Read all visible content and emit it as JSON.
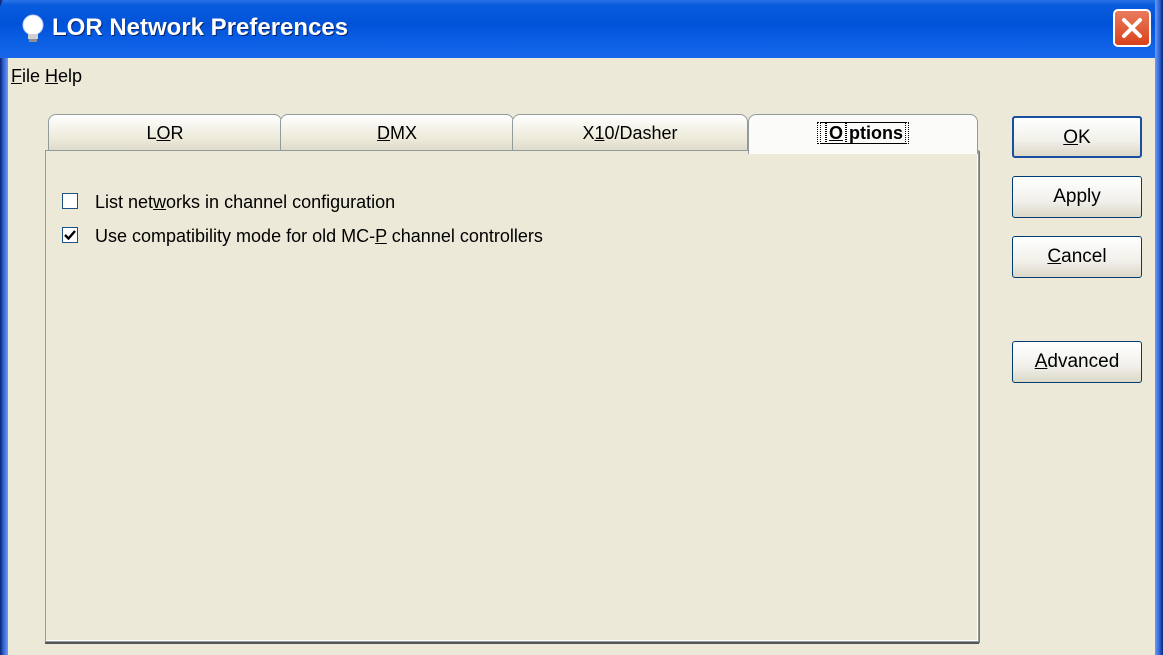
{
  "window": {
    "title": "LOR Network Preferences"
  },
  "menu": [
    {
      "label": "File",
      "mnemonic": "F",
      "rest": "ile"
    },
    {
      "label": "Help",
      "mnemonic": "H",
      "rest": "elp"
    }
  ],
  "tabs": [
    {
      "label": "LOR",
      "pre": "L",
      "ul": "O",
      "post": "R",
      "active": false
    },
    {
      "label": "DMX",
      "pre": "",
      "ul": "D",
      "post": "MX",
      "active": false
    },
    {
      "label": "X10/Dasher",
      "pre": "X",
      "ul": "1",
      "post": "0/Dasher",
      "active": false
    },
    {
      "label": "Options",
      "pre": "",
      "ul": "O",
      "post": "ptions",
      "active": true
    }
  ],
  "options": {
    "list_networks": {
      "checked": false,
      "pre": "List net",
      "ul": "w",
      "post": "orks in channel configuration",
      "label": "List networks in channel configuration"
    },
    "compat_mode": {
      "checked": true,
      "pre": "Use compatibility mode for old MC-",
      "ul": "P",
      "post": " channel controllers",
      "label": "Use compatibility mode for old MC-P channel controllers"
    }
  },
  "buttons": {
    "ok": {
      "pre": "",
      "ul": "O",
      "post": "K",
      "label": "OK"
    },
    "apply": {
      "pre": "",
      "ul": "",
      "post": "Apply",
      "label": "Apply"
    },
    "cancel": {
      "pre": "",
      "ul": "C",
      "post": "ancel",
      "label": "Cancel"
    },
    "advanced": {
      "pre": "",
      "ul": "A",
      "post": "dvanced",
      "label": "Advanced"
    }
  },
  "colors": {
    "titlebar": "#0052d8",
    "face": "#ece9d8",
    "close": "#d9421c"
  }
}
